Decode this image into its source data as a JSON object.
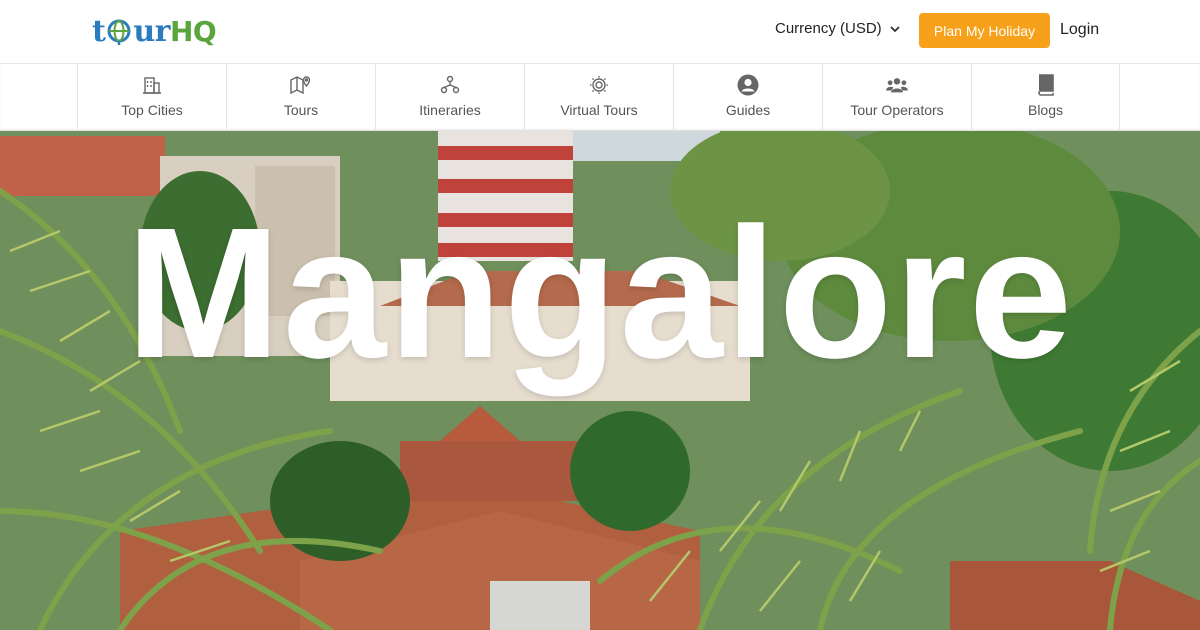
{
  "header": {
    "logo_text": "tourHQ",
    "currency_label": "Currency (USD)",
    "plan_button_label": "Plan My Holiday",
    "login_label": "Login"
  },
  "nav": {
    "items": [
      {
        "label": "Top Cities",
        "icon": "building-icon"
      },
      {
        "label": "Tours",
        "icon": "map-pin-icon"
      },
      {
        "label": "Itineraries",
        "icon": "itinerary-icon"
      },
      {
        "label": "Virtual Tours",
        "icon": "virtual-tour-icon"
      },
      {
        "label": "Guides",
        "icon": "user-circle-icon"
      },
      {
        "label": "Tour Operators",
        "icon": "users-icon"
      },
      {
        "label": "Blogs",
        "icon": "book-icon"
      }
    ]
  },
  "hero": {
    "title": "Mangalore"
  },
  "colors": {
    "accent": "#f7a11a",
    "logo_blue": "#2b7bbf",
    "logo_green": "#5aa63c",
    "nav_text": "#555555"
  }
}
